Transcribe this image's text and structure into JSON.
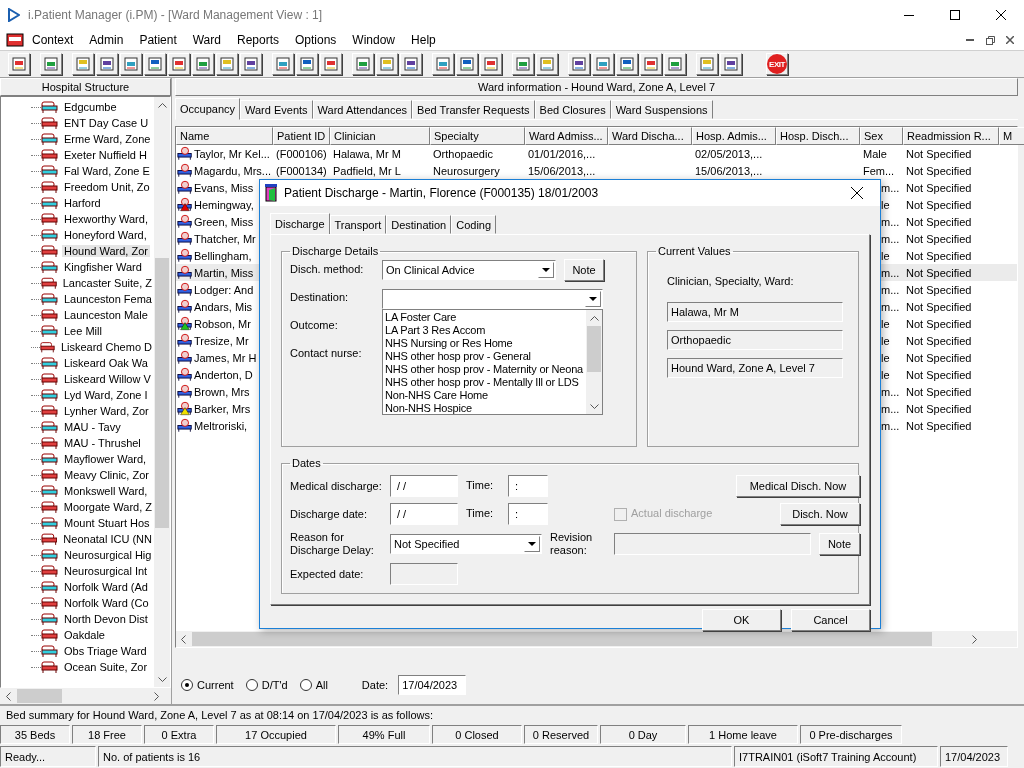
{
  "window": {
    "title": "i.Patient Manager (i.PM) - [Ward Management View : 1]"
  },
  "menu": [
    "Context",
    "Admin",
    "Patient",
    "Ward",
    "Reports",
    "Options",
    "Window",
    "Help"
  ],
  "toolbar": {
    "exit_label": "EXIT"
  },
  "sidebar": {
    "title": "Hospital Structure",
    "items": [
      {
        "label": "Edgcumbe",
        "selected": false
      },
      {
        "label": "ENT Day Case U",
        "selected": false
      },
      {
        "label": "Erme Ward, Zone",
        "selected": false
      },
      {
        "label": "Exeter Nuffield H",
        "selected": false
      },
      {
        "label": "Fal Ward, Zone E",
        "selected": false
      },
      {
        "label": "Freedom Unit, Zo",
        "selected": false
      },
      {
        "label": "Harford",
        "selected": false
      },
      {
        "label": "Hexworthy Ward,",
        "selected": false
      },
      {
        "label": "Honeyford Ward,",
        "selected": false
      },
      {
        "label": "Hound Ward, Zor",
        "selected": true
      },
      {
        "label": "Kingfisher Ward",
        "selected": false
      },
      {
        "label": "Lancaster Suite, Z",
        "selected": false
      },
      {
        "label": "Launceston Fema",
        "selected": false
      },
      {
        "label": "Launceston Male",
        "selected": false
      },
      {
        "label": "Lee Mill",
        "selected": false
      },
      {
        "label": "Liskeard Chemo D",
        "selected": false
      },
      {
        "label": "Liskeard Oak Wa",
        "selected": false
      },
      {
        "label": "Liskeard Willow V",
        "selected": false
      },
      {
        "label": "Lyd Ward, Zone I",
        "selected": false
      },
      {
        "label": "Lynher Ward, Zor",
        "selected": false
      },
      {
        "label": "MAU - Tavy",
        "selected": false
      },
      {
        "label": "MAU - Thrushel",
        "selected": false
      },
      {
        "label": "Mayflower Ward,",
        "selected": false
      },
      {
        "label": "Meavy Clinic, Zor",
        "selected": false
      },
      {
        "label": "Monkswell Ward,",
        "selected": false
      },
      {
        "label": "Moorgate Ward, Z",
        "selected": false
      },
      {
        "label": "Mount Stuart Hos",
        "selected": false
      },
      {
        "label": "Neonatal ICU (NN",
        "selected": false
      },
      {
        "label": "Neurosurgical Hig",
        "selected": false
      },
      {
        "label": "Neurosurgical Int",
        "selected": false
      },
      {
        "label": "Norfolk Ward (Ad",
        "selected": false
      },
      {
        "label": "Norfolk Ward (Co",
        "selected": false
      },
      {
        "label": "North Devon Dist",
        "selected": false
      },
      {
        "label": "Oakdale",
        "selected": false
      },
      {
        "label": "Obs Triage Ward",
        "selected": false
      },
      {
        "label": "Ocean Suite, Zor",
        "selected": false
      }
    ]
  },
  "ward_info": "Ward information - Hound Ward, Zone A, Level 7",
  "tabs": [
    {
      "label": "Occupancy",
      "selected": true
    },
    {
      "label": "Ward Events",
      "selected": false
    },
    {
      "label": "Ward Attendances",
      "selected": false
    },
    {
      "label": "Bed Transfer Requests",
      "selected": false
    },
    {
      "label": "Bed Closures",
      "selected": false
    },
    {
      "label": "Ward Suspensions",
      "selected": false
    }
  ],
  "table": {
    "columns": [
      "Name",
      "Patient ID",
      "Clinician",
      "Specialty",
      "Ward Admiss...",
      "Ward Discha...",
      "Hosp. Admis...",
      "Hosp. Disch...",
      "Sex",
      "Readmission R...",
      "M"
    ],
    "rows": [
      {
        "name": "Taylor, Mr Kel...",
        "patient_id": "(F000106)",
        "clinician": "Halawa, Mr M",
        "specialty": "Orthopaedic",
        "ward_admission": "01/01/2016,...",
        "hosp_admission": "02/05/2013,...",
        "sex": "Male",
        "readmission": "Not Specified",
        "selected": false
      },
      {
        "name": "Magardu, Mrs...",
        "patient_id": "(F000134)",
        "clinician": "Padfield, Mr L",
        "specialty": "Neurosurgery",
        "ward_admission": "15/06/2013,...",
        "hosp_admission": "15/06/2013,...",
        "sex": "Fem...",
        "readmission": "Not Specified",
        "selected": false
      },
      {
        "name": "Evans, Miss",
        "sex": "m...",
        "readmission": "Not Specified",
        "selected": false
      },
      {
        "name": "Hemingway,",
        "sex": "le",
        "readmission": "Not Specified",
        "selected": false,
        "color": "#e00000"
      },
      {
        "name": "Green, Miss",
        "sex": "m...",
        "readmission": "Not Specified",
        "selected": false
      },
      {
        "name": "Thatcher, Mr",
        "sex": "m...",
        "readmission": "Not Specified",
        "selected": false
      },
      {
        "name": "Bellingham,",
        "sex": "le",
        "readmission": "Not Specified",
        "selected": false
      },
      {
        "name": "Martin, Miss",
        "sex": "m...",
        "readmission": "Not Specified",
        "selected": true
      },
      {
        "name": "Lodger: And",
        "sex": "m...",
        "readmission": "Not Specified",
        "selected": false
      },
      {
        "name": "Andars, Mis",
        "sex": "m...",
        "readmission": "Not Specified",
        "selected": false
      },
      {
        "name": "Robson, Mr",
        "sex": "le",
        "readmission": "Not Specified",
        "selected": false,
        "color": "#20c020"
      },
      {
        "name": "Tresize, Mr",
        "sex": "le",
        "readmission": "Not Specified",
        "selected": false
      },
      {
        "name": "James, Mr H",
        "sex": "le",
        "readmission": "Not Specified",
        "selected": false
      },
      {
        "name": "Anderton, D",
        "sex": "le",
        "readmission": "Not Specified",
        "selected": false
      },
      {
        "name": "Brown, Mrs",
        "sex": "m...",
        "readmission": "Not Specified",
        "selected": false
      },
      {
        "name": "Barker, Mrs",
        "sex": "m...",
        "readmission": "Not Specified",
        "selected": false,
        "color": "#f0e000"
      },
      {
        "name": "Meltroriski,",
        "sex": "m...",
        "readmission": "Not Specified",
        "selected": false
      }
    ]
  },
  "filter": {
    "radios": [
      {
        "label": "Current",
        "selected": true
      },
      {
        "label": "D/T'd",
        "selected": false
      },
      {
        "label": "All",
        "selected": false
      }
    ],
    "date_label": "Date:",
    "date": "17/04/2023"
  },
  "dialog": {
    "title": "Patient Discharge - Martin, Florence (F000135) 18/01/2003",
    "tabs": [
      {
        "label": "Discharge",
        "selected": true
      },
      {
        "label": "Transport",
        "selected": false
      },
      {
        "label": "Destination",
        "selected": false
      },
      {
        "label": "Coding",
        "selected": false
      }
    ],
    "discharge_details": {
      "legend": "Discharge Details",
      "method_label": "Disch. method:",
      "method": "On Clinical Advice",
      "note": "Note",
      "destination_label": "Destination:",
      "destination_options": [
        "LA Foster Care",
        "LA Part 3 Res Accom",
        "NHS Nursing or Res Home",
        "NHS other hosp prov - General",
        "NHS other hosp prov - Maternity or Neona",
        "NHS other hosp prov - Mentally Ill or LDS",
        "Non-NHS Care Home",
        "Non-NHS Hospice"
      ],
      "outcome_label": "Outcome:",
      "contact_nurse_label": "Contact nurse:"
    },
    "current_values": {
      "legend": "Current Values",
      "caption": "Clinician, Specialty, Ward:",
      "values": [
        "Halawa, Mr M",
        "Orthopaedic",
        "Hound Ward, Zone A, Level 7"
      ]
    },
    "dates": {
      "legend": "Dates",
      "medical_discharge_label": "Medical discharge:",
      "medical_discharge": "/ /",
      "medical_time_label": "Time:",
      "medical_time": ":",
      "medical_now": "Medical Disch. Now",
      "discharge_date_label": "Discharge date:",
      "discharge_date": "/ /",
      "discharge_time_label": "Time:",
      "discharge_time": ":",
      "actual_discharge": {
        "label": "Actual discharge",
        "checked": false,
        "disabled": true
      },
      "disch_now": "Disch. Now",
      "delay_label": "Reason for Discharge Delay:",
      "delay": "Not Specified",
      "revision_label": "Revision reason:",
      "revision_note": "Note",
      "expected_label": "Expected date:"
    },
    "buttons": [
      "OK",
      "Cancel"
    ]
  },
  "bed_summary": {
    "text": "Bed summary for Hound Ward, Zone A, Level 7 as at 08:14 on 17/04/2023 is as follows:",
    "counts": [
      "35 Beds",
      "18 Free",
      "0 Extra",
      "17 Occupied",
      "49% Full",
      "0 Closed",
      "0 Reserved",
      "0 Day",
      "1 Home leave",
      "0 Pre-discharges"
    ]
  },
  "status_bar": [
    "Ready...",
    "No. of patients is 16",
    "I7TRAIN01 (iSoft7 Training Account)",
    "17/04/2023"
  ]
}
